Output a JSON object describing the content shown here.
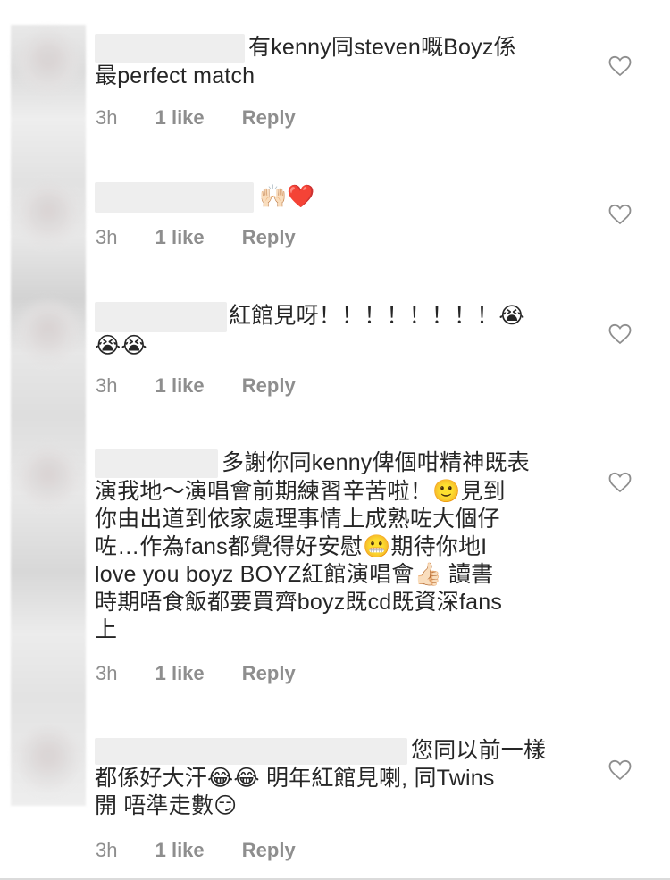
{
  "comments": [
    {
      "lines": [
        "有kenny同steven嘅Boyz係",
        "最perfect match"
      ],
      "time": "3h",
      "likes": "1 like",
      "reply": "Reply"
    },
    {
      "lines": [
        "🙌🏻❤️"
      ],
      "time": "3h",
      "likes": "1 like",
      "reply": "Reply"
    },
    {
      "lines": [
        "紅館見呀！！！！！！！！😭",
        "😭😭"
      ],
      "time": "3h",
      "likes": "1 like",
      "reply": "Reply"
    },
    {
      "lines": [
        "多謝你同kenny俾個咁精神既表",
        "演我地～演唱會前期練習辛苦啦！🙂見到",
        "你由出道到依家處理事情上成熟咗大個仔",
        "咗…作為fans都覺得好安慰😬期待你地I",
        "love you boyz BOYZ紅館演唱會👍🏻 讀書",
        "時期唔食飯都要買齊boyz既cd既資深fans",
        "上"
      ],
      "time": "3h",
      "likes": "1 like",
      "reply": "Reply"
    },
    {
      "lines": [
        "您同以前一樣",
        "都係好大汗😂😂 明年紅館見喇, 同Twins",
        "開 唔準走數😏"
      ],
      "time": "3h",
      "likes": "1 like",
      "reply": "Reply"
    }
  ],
  "icons": {
    "like": "heart-outline-icon"
  },
  "colors": {
    "text": "#262626",
    "meta": "#8e8e8e",
    "redaction": "#eeeeee"
  }
}
